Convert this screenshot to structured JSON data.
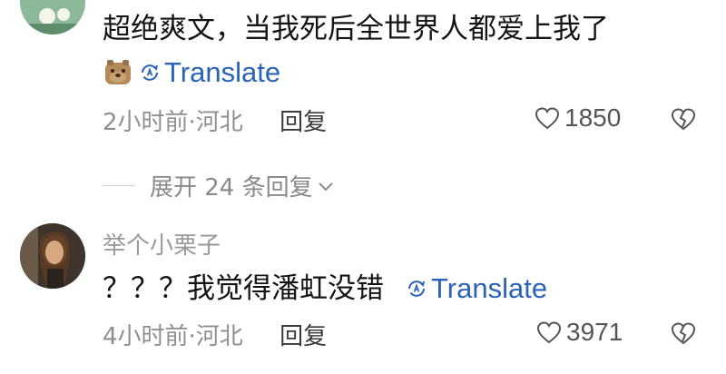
{
  "comments": [
    {
      "text": "超绝爽文，当我死后全世界人都爱上我了",
      "translate": "Translate",
      "meta": "2小时前·河北",
      "reply": "回复",
      "likes": "1850"
    },
    {
      "username": "举个小栗子",
      "text": "？？？我觉得潘虹没错",
      "translate": "Translate",
      "meta": "4小时前·河北",
      "reply": "回复",
      "likes": "3971"
    }
  ],
  "expand_replies": "展开 24 条回复",
  "icons": {
    "like": "heart-icon",
    "dislike": "broken-heart-icon",
    "translate": "translate-icon",
    "expand": "chevron-down-icon"
  },
  "colors": {
    "link": "#2a63b8",
    "meta": "#8f8f8f"
  }
}
